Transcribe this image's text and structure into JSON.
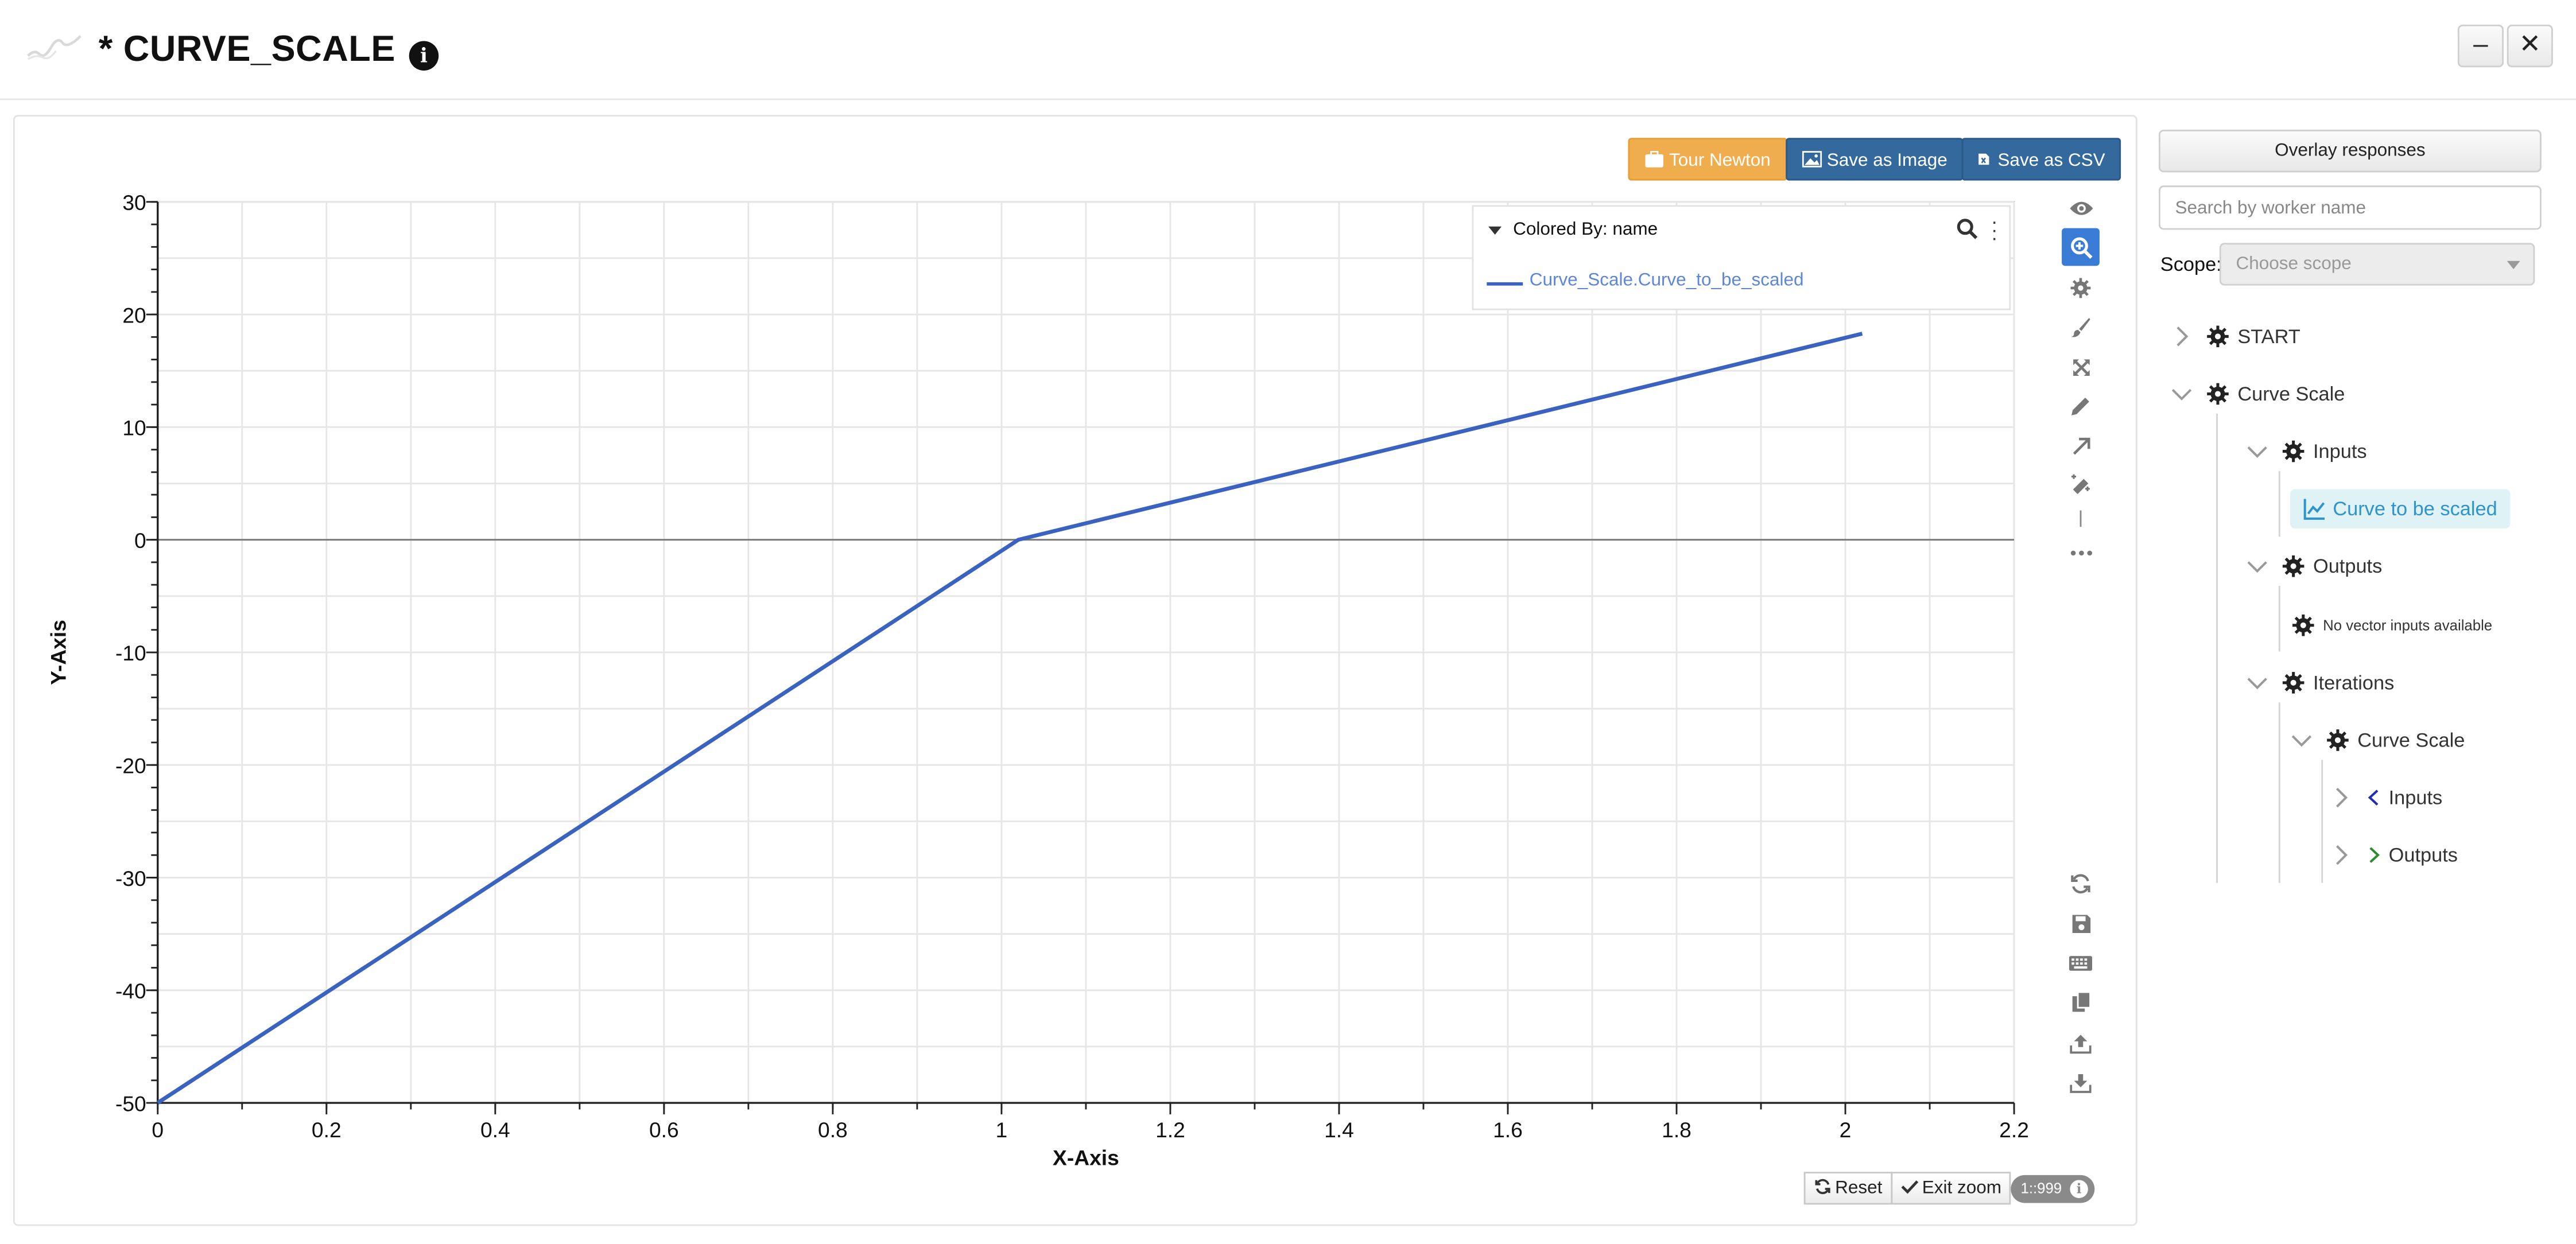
{
  "header": {
    "title": "* CURVE_SCALE",
    "minimize_label": "–",
    "close_label": "✕"
  },
  "toolbar_top": {
    "tour_label": "Tour Newton",
    "save_image_label": "Save as Image",
    "save_csv_label": "Save as CSV"
  },
  "legend": {
    "header": "Colored By: name",
    "entries": [
      "Curve_Scale.Curve_to_be_scaled"
    ]
  },
  "plot_tools": [
    "eye-icon",
    "zoom-in-icon",
    "gear-icon",
    "brush-icon",
    "expand-icon",
    "pencil-icon",
    "arrow-icon",
    "eraser-icon",
    "divider",
    "more-icon",
    "refresh-icon",
    "save-icon",
    "keyboard-icon",
    "copy-icon",
    "upload-icon",
    "download-icon"
  ],
  "zoom_controls": {
    "reset_label": "Reset",
    "exit_zoom_label": "Exit zoom",
    "ratio_badge": "1::999"
  },
  "sidebar": {
    "overlay_label": "Overlay responses",
    "search_placeholder": "Search by worker name",
    "scope_label": "Scope:",
    "scope_placeholder": "Choose scope",
    "tree": {
      "start": "START",
      "curve_scale": "Curve Scale",
      "inputs": "Inputs",
      "curve_to_be_scaled": "Curve to be scaled",
      "outputs": "Outputs",
      "no_vector": "No vector inputs available",
      "iterations": "Iterations",
      "iter_curve_scale": "Curve Scale",
      "iter_inputs": "Inputs",
      "iter_outputs": "Outputs"
    }
  },
  "colors": {
    "series": "#3a62c0",
    "orange_button": "#f0ad4e",
    "blue_button": "#34699d",
    "highlight_text": "#2f94c9"
  },
  "chart_data": {
    "type": "line",
    "title": "",
    "xlabel": "X-Axis",
    "ylabel": "Y-Axis",
    "xlim": [
      0,
      2.2
    ],
    "ylim": [
      -50,
      30
    ],
    "xticks": [
      0,
      0.2,
      0.4,
      0.6,
      0.8,
      1,
      1.2,
      1.4,
      1.6,
      1.8,
      2,
      2.2
    ],
    "yticks": [
      -50,
      -40,
      -30,
      -20,
      -10,
      0,
      10,
      20,
      30
    ],
    "xtick_labels": [
      "0",
      "0.2",
      "0.4",
      "0.6",
      "0.8",
      "1",
      "1.2",
      "1.4",
      "1.6",
      "1.8",
      "2",
      "2.2"
    ],
    "ytick_labels": [
      "-50",
      "-40",
      "-30",
      "-20",
      "-10",
      "0",
      "10",
      "20",
      "30"
    ],
    "grid": true,
    "legend_position": "top-right",
    "series": [
      {
        "name": "Curve_Scale.Curve_to_be_scaled",
        "x": [
          0,
          1.02,
          2.02
        ],
        "y": [
          -50,
          0,
          18.3
        ]
      }
    ]
  }
}
